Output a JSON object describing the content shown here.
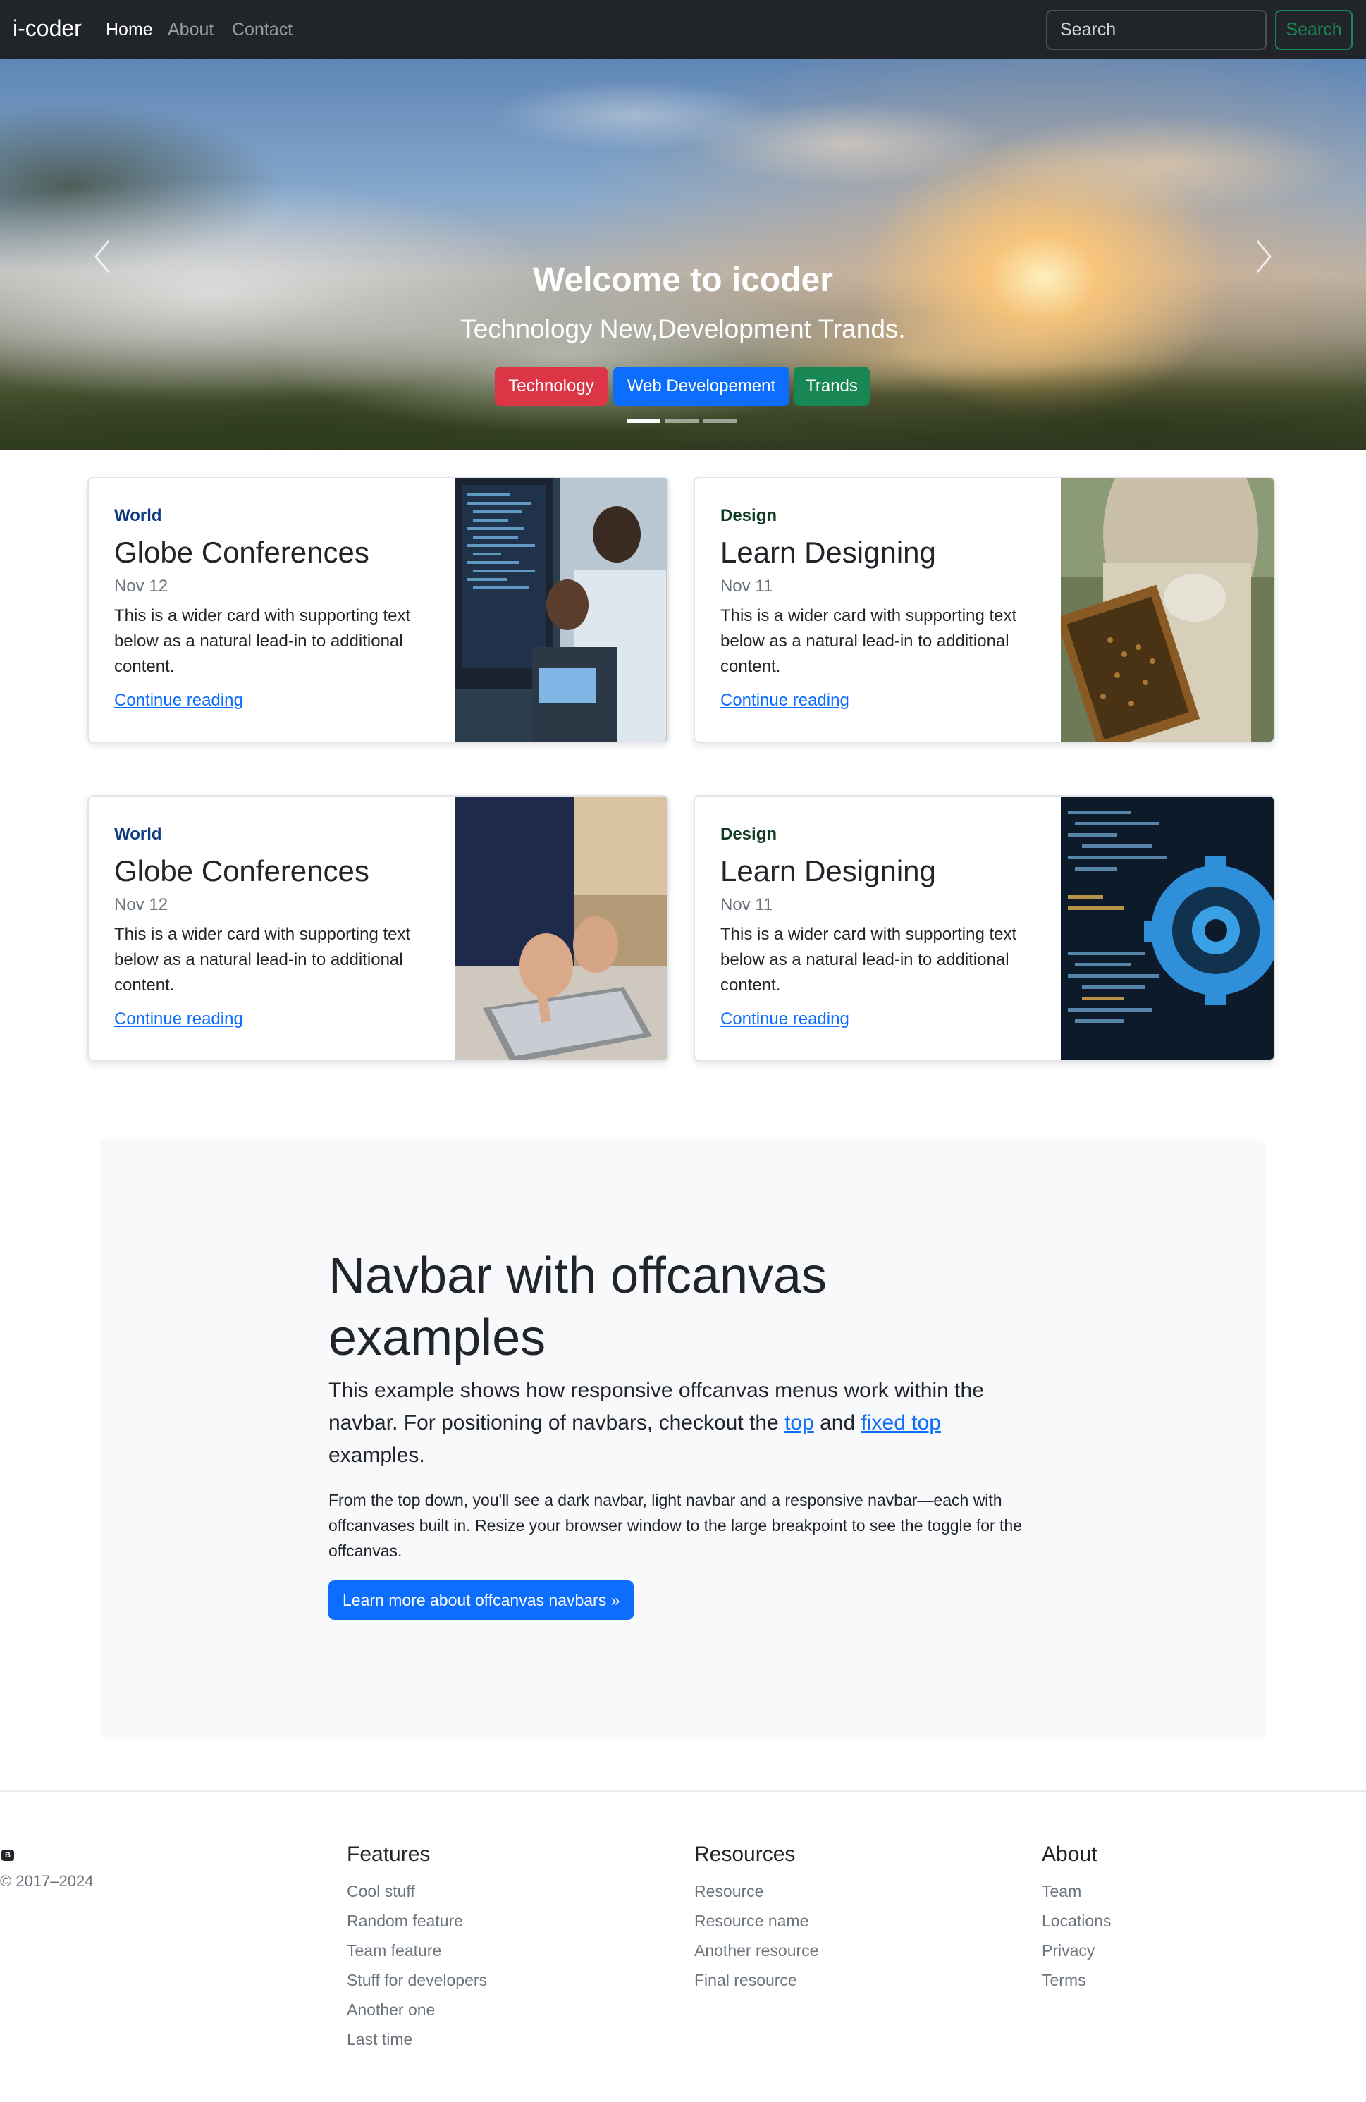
{
  "navbar": {
    "brand": "i-coder",
    "links": [
      "Home",
      "About",
      "Contact"
    ],
    "search_placeholder": "Search",
    "search_button": "Search"
  },
  "hero": {
    "title": "Welcome to icoder",
    "subtitle": "Technology New,Development Trands.",
    "buttons": [
      {
        "label": "Technology",
        "color": "#dc3545"
      },
      {
        "label": "Web Developement",
        "color": "#0d6efd"
      },
      {
        "label": "Trands",
        "color": "#198754"
      }
    ],
    "active_slide": 1,
    "slide_count": 3
  },
  "cards": [
    {
      "category": "World",
      "title": "Globe Conferences",
      "date": "Nov 12",
      "text": "This is a wider card with supporting text below as a natural lead-in to additional content.",
      "link": "Continue reading"
    },
    {
      "category": "Design",
      "title": "Learn Designing",
      "date": "Nov 11",
      "text": "This is a wider card with supporting text below as a natural lead-in to additional content.",
      "link": "Continue reading"
    },
    {
      "category": "World",
      "title": "Globe Conferences",
      "date": "Nov 12",
      "text": "This is a wider card with supporting text below as a natural lead-in to additional content.",
      "link": "Continue reading"
    },
    {
      "category": "Design",
      "title": "Learn Designing",
      "date": "Nov 11",
      "text": "This is a wider card with supporting text below as a natural lead-in to additional content.",
      "link": "Continue reading"
    }
  ],
  "jumbotron": {
    "heading": "Navbar with offcanvas examples",
    "lead_before": "This example shows how responsive offcanvas menus work within the navbar. For positioning of navbars, checkout the ",
    "lead_link1": "top",
    "lead_middle": " and ",
    "lead_link2": "fixed top",
    "lead_after": " examples.",
    "paragraph": "From the top down, you'll see a dark navbar, light navbar and a responsive navbar—each with offcanvases built in. Resize your browser window to the large breakpoint to see the toggle for the offcanvas.",
    "button": "Learn more about offcanvas navbars »"
  },
  "footer": {
    "logo_letter": "B",
    "copyright": "© 2017–2024",
    "columns": [
      {
        "title": "Features",
        "items": [
          "Cool stuff",
          "Random feature",
          "Team feature",
          "Stuff for developers",
          "Another one",
          "Last time"
        ]
      },
      {
        "title": "Resources",
        "items": [
          "Resource",
          "Resource name",
          "Another resource",
          "Final resource"
        ]
      },
      {
        "title": "About",
        "items": [
          "Team",
          "Locations",
          "Privacy",
          "Terms"
        ]
      }
    ]
  }
}
